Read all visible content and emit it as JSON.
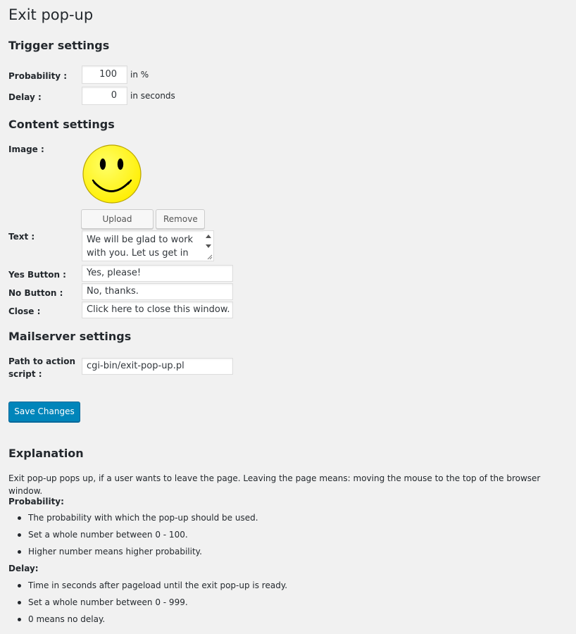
{
  "page": {
    "title": "Exit pop-up"
  },
  "trigger": {
    "heading": "Trigger settings",
    "probability": {
      "label": "Probability :",
      "value": "100",
      "suffix": "in %"
    },
    "delay": {
      "label": "Delay :",
      "value": "0",
      "suffix": "in seconds"
    }
  },
  "content": {
    "heading": "Content settings",
    "image": {
      "label": "Image :",
      "icon": "smiley-face-icon",
      "face_color": "#ffff00"
    },
    "upload_button": "Upload image",
    "remove_button": "Remove",
    "text": {
      "label": "Text :",
      "value": "We will be glad to work with you. Let us get in"
    },
    "yes_button": {
      "label": "Yes Button :",
      "value": "Yes, please!"
    },
    "no_button": {
      "label": "No Button :",
      "value": "No, thanks."
    },
    "close": {
      "label": "Close :",
      "value": "Click here to close this window."
    }
  },
  "mailserver": {
    "heading": "Mailserver settings",
    "path": {
      "label_line1": "Path to action",
      "label_line2": "script :",
      "value": "cgi-bin/exit-pop-up.pl"
    }
  },
  "save_button": "Save Changes",
  "explanation": {
    "heading": "Explanation",
    "intro": "Exit pop-up pops up, if a user wants to leave the page. Leaving the page means: moving the mouse to the top of the browser window.",
    "probability": {
      "title": "Probability:",
      "items": [
        "The probability with which the pop-up should be used.",
        "Set a whole number between 0 - 100.",
        "Higher number means higher probability."
      ]
    },
    "delay": {
      "title": "Delay:",
      "items": [
        "Time in seconds after pageload until the exit pop-up is ready.",
        "Set a whole number between 0 - 999.",
        "0 means no delay."
      ]
    }
  },
  "colors": {
    "primary": "#0085ba",
    "background": "#f1f1f1"
  }
}
